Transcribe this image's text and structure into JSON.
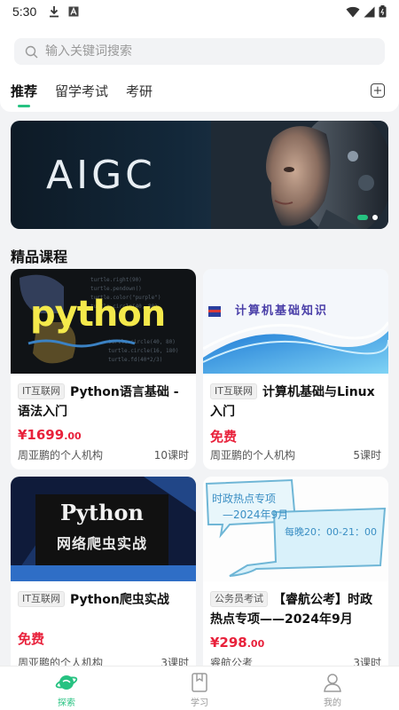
{
  "status": {
    "time": "5:30"
  },
  "search": {
    "placeholder": "输入关键词搜索"
  },
  "tabs": [
    {
      "label": "推荐",
      "active": true
    },
    {
      "label": "留学考试",
      "active": false
    },
    {
      "label": "考研",
      "active": false
    }
  ],
  "banner": {
    "text": "AIGC",
    "dots": 2,
    "active_dot": 0
  },
  "section": {
    "title": "精品课程"
  },
  "courses": [
    {
      "cover_text": "python",
      "tag": "IT互联网",
      "title": "Python语言基础 - 语法入门",
      "price_main": "¥1699",
      "price_dec": ".00",
      "org": "周亚鹏的个人机构",
      "lessons": "10课时"
    },
    {
      "cover_text": "计算机基础知识",
      "tag": "IT互联网",
      "title": "计算机基础与Linux入门",
      "price_main": "免费",
      "price_dec": "",
      "org": "周亚鹏的个人机构",
      "lessons": "5课时"
    },
    {
      "cover_text": "Python",
      "cover_sub": "网络爬虫实战",
      "tag": "IT互联网",
      "title": "Python爬虫实战",
      "price_main": "免费",
      "price_dec": "",
      "org": "周亚鹏的个人机构",
      "lessons": "3课时"
    },
    {
      "cover_text": "时政热点专项",
      "cover_sub": "—2024年9月",
      "cover_time": "每晚20：00-21：00",
      "tag": "公务员考试",
      "title": "【睿航公考】时政热点专项——2024年9月",
      "price_main": "¥298",
      "price_dec": ".00",
      "org": "睿航公考",
      "lessons": "3课时"
    }
  ],
  "bottom_nav": [
    {
      "label": "探索",
      "icon": "planet-icon",
      "active": true
    },
    {
      "label": "学习",
      "icon": "book-icon",
      "active": false
    },
    {
      "label": "我的",
      "icon": "user-icon",
      "active": false
    }
  ],
  "colors": {
    "accent": "#26c281",
    "price": "#e8213b"
  }
}
